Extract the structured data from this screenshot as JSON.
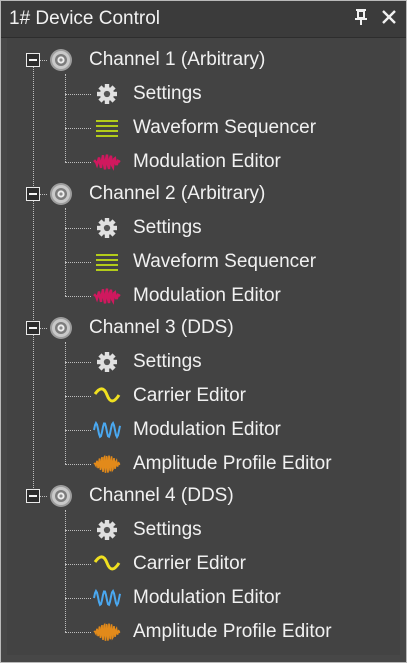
{
  "window": {
    "title": "1# Device Control",
    "pin_glyph": "⍐",
    "close_glyph": "✕"
  },
  "tree": {
    "channels": [
      {
        "label": "Channel 1 (Arbitrary)",
        "expanded": true,
        "items": [
          {
            "label": "Settings",
            "icon": "gear-icon"
          },
          {
            "label": "Waveform Sequencer",
            "icon": "waveform-sequencer-icon"
          },
          {
            "label": "Modulation Editor",
            "icon": "modulation-editor-pink-icon"
          }
        ]
      },
      {
        "label": "Channel 2 (Arbitrary)",
        "expanded": true,
        "items": [
          {
            "label": "Settings",
            "icon": "gear-icon"
          },
          {
            "label": "Waveform Sequencer",
            "icon": "waveform-sequencer-icon"
          },
          {
            "label": "Modulation Editor",
            "icon": "modulation-editor-pink-icon"
          }
        ]
      },
      {
        "label": "Channel 3 (DDS)",
        "expanded": true,
        "items": [
          {
            "label": "Settings",
            "icon": "gear-icon"
          },
          {
            "label": "Carrier Editor",
            "icon": "carrier-wave-icon"
          },
          {
            "label": "Modulation Editor",
            "icon": "modulation-editor-blue-icon"
          },
          {
            "label": "Amplitude Profile Editor",
            "icon": "amplitude-profile-icon"
          }
        ]
      },
      {
        "label": "Channel 4 (DDS)",
        "expanded": true,
        "items": [
          {
            "label": "Settings",
            "icon": "gear-icon"
          },
          {
            "label": "Carrier Editor",
            "icon": "carrier-wave-icon"
          },
          {
            "label": "Modulation Editor",
            "icon": "modulation-editor-blue-icon"
          },
          {
            "label": "Amplitude Profile Editor",
            "icon": "amplitude-profile-icon"
          }
        ]
      }
    ]
  },
  "colors": {
    "background": "#434343",
    "titlebar": "#3b3b3b",
    "text": "#f1f1f1",
    "sequencer_green": "#b3cc1a",
    "modulation_pink": "#d0185e",
    "carrier_yellow": "#f0e020",
    "modulation_blue": "#4aa8f0",
    "amplitude_orange": "#e28a1a"
  }
}
